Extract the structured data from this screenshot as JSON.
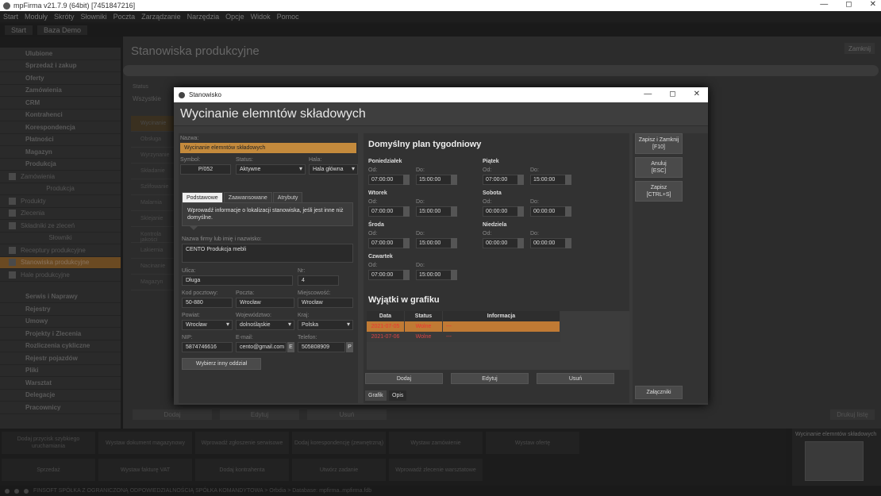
{
  "os": {
    "title": "mpFirma v21.7.9 (64bit) [7451847216]",
    "ctrl_min": "—",
    "ctrl_max": "◻",
    "ctrl_close": "✕"
  },
  "menubar": [
    "Start",
    "Moduły",
    "Skróty",
    "Słowniki",
    "Poczta",
    "Zarządzanie",
    "Narzędzia",
    "Opcje",
    "Widok",
    "Pomoc"
  ],
  "toptabs": [
    "Start",
    "Baza Demo"
  ],
  "sidebar": {
    "items": [
      {
        "label": "Ulubione"
      },
      {
        "label": "Sprzedaż i zakup"
      },
      {
        "label": "Oferty"
      },
      {
        "label": "Zamówienia"
      },
      {
        "label": "CRM"
      },
      {
        "label": "Kontrahenci"
      },
      {
        "label": "Korespondencja"
      },
      {
        "label": "Płatności"
      },
      {
        "label": "Magazyn"
      },
      {
        "label": "Produkcja"
      }
    ],
    "sub_items": [
      {
        "label": "Zamówienia"
      },
      {
        "label": "Produkcja"
      },
      {
        "label": "Produkty"
      },
      {
        "label": "Zlecenia"
      },
      {
        "label": "Składniki ze zleceń"
      },
      {
        "label": "Słowniki"
      },
      {
        "label": "Receptury produkcyjne"
      },
      {
        "label": "Stanowiska produkcyjne"
      },
      {
        "label": "Hale produkcyjne"
      }
    ],
    "bottom_items": [
      {
        "label": "Serwis i Naprawy"
      },
      {
        "label": "Rejestry"
      },
      {
        "label": "Umowy"
      },
      {
        "label": "Projekty i Zlecenia"
      },
      {
        "label": "Rozliczenia cykliczne"
      },
      {
        "label": "Rejestr pojazdów"
      },
      {
        "label": "Pliki"
      },
      {
        "label": "Warsztat"
      },
      {
        "label": "Delegacje"
      },
      {
        "label": "Pracownicy"
      }
    ]
  },
  "main": {
    "title": "Stanowiska produkcyjne",
    "close": "Zamknij",
    "status_label": "Status",
    "status_value": "Wszystkie",
    "list": [
      "Wycinanie",
      "Obsługa",
      "Wyrzynanie",
      "Składanie",
      "Szlifowanie",
      "Malarnia",
      "Sklejanie",
      "Kontrola jakości",
      "Lakiernia",
      "Nacinanie",
      "Magazyn"
    ],
    "btn_add": "Dodaj",
    "btn_edit": "Edytuj",
    "btn_delete": "Usuń",
    "btn_print": "Drukuj listę"
  },
  "quick": [
    "Dodaj przycisk szybkiego uruchamiania",
    "Wystaw dokument magazynowy",
    "Wprowadź zgłoszenie serwisowe",
    "Dodaj korespondencję (zewnętrzną)",
    "Wystaw zamówienie",
    "Wystaw ofertę",
    "Sprzedaż",
    "Wystaw fakturę VAT",
    "Dodaj kontrahenta",
    "Utwórz zadanie",
    "Wprowadź zlecenie warsztatowe"
  ],
  "thumb_label": "Wycinanie elemntów składowych",
  "statusbar": "FINSOFT SPÓŁKA Z OGRANICZONĄ ODPOWIEDZIALNOŚCIĄ SPÓŁKA KOMANDYTOWA > Orbdia > Database: mpfirma..mpfirma.fdb",
  "dialog": {
    "window_title": "Stanowisko",
    "heading": "Wycinanie elemntów składowych",
    "name_label": "Nazwa:",
    "name_value": "Wycinanie elemntów składowych",
    "symbol_label": "Symbol:",
    "symbol_value": "P/052",
    "status_label": "Status:",
    "status_value": "Aktywne",
    "hall_label": "Hala:",
    "hall_value": "Hala główna",
    "tabs": [
      "Podstawowe",
      "Zaawansowane",
      "Atrybuty"
    ],
    "info": "Wprowadź informacje o lokalizacji stanowiska, jeśli jest inne niż domyślne.",
    "company_label": "Nazwa firmy lub imię i nazwisko:",
    "company_value": "CENTO Produkcja mebli",
    "street_label": "Ulica:",
    "street_value": "Długa",
    "nr_label": "Nr:",
    "nr_value": "4",
    "postal_label": "Kod pocztowy:",
    "postal_value": "50-880",
    "post_label": "Poczta:",
    "post_value": "Wrocław",
    "city_label": "Miejscowość:",
    "city_value": "Wrocław",
    "county_label": "Powiat:",
    "county_value": "Wrocław",
    "voiv_label": "Województwo:",
    "voiv_value": "dolnośląskie",
    "country_label": "Kraj:",
    "country_value": "Polska",
    "nip_label": "NIP:",
    "nip_value": "5874746616",
    "email_label": "E-mail:",
    "email_value": "cento@gmail.com",
    "email_btn": "E",
    "phone_label": "Telefon:",
    "phone_value": "505808909",
    "phone_btn": "P",
    "choose_branch": "Wybierz inny oddział"
  },
  "plan": {
    "title": "Domyślny plan tygodniowy",
    "from_label": "Od:",
    "to_label": "Do:",
    "days": [
      {
        "name": "Poniedziałek",
        "from": "07:00:00",
        "to": "15:00:00"
      },
      {
        "name": "Wtorek",
        "from": "07:00:00",
        "to": "15:00:00"
      },
      {
        "name": "Środa",
        "from": "07:00:00",
        "to": "15:00:00"
      },
      {
        "name": "Czwartek",
        "from": "07:00:00",
        "to": "15:00:00"
      },
      {
        "name": "Piątek",
        "from": "07:00:00",
        "to": "15:00:00"
      },
      {
        "name": "Sobota",
        "from": "00:00:00",
        "to": "00:00:00"
      },
      {
        "name": "Niedziela",
        "from": "00:00:00",
        "to": "00:00:00"
      }
    ],
    "exceptions_title": "Wyjątki w grafiku",
    "exc_headers": [
      "Data",
      "Status",
      "Informacja"
    ],
    "exc_rows": [
      {
        "date": "2021-07-05",
        "status": "Wolne",
        "info": "---"
      },
      {
        "date": "2021-07-06",
        "status": "Wolne",
        "info": "---"
      }
    ],
    "btn_add": "Dodaj",
    "btn_edit": "Edytuj",
    "btn_delete": "Usuń",
    "bottom_tabs": [
      "Grafik",
      "Opis"
    ]
  },
  "actions": {
    "save_close": "Zapisz i Zamknij",
    "save_close_key": "[F10]",
    "cancel": "Anuluj",
    "cancel_key": "[ESC]",
    "save": "Zapisz",
    "save_key": "[CTRL+S]",
    "attachments": "Załączniki"
  }
}
